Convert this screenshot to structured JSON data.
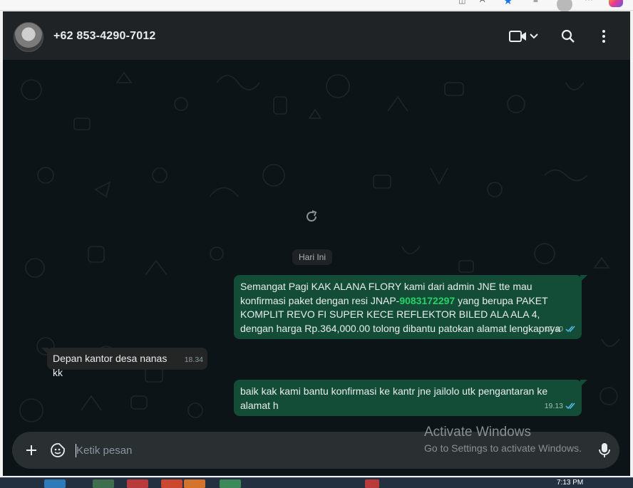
{
  "browser": {
    "icons": [
      "reader-icon",
      "font-icon",
      "star-icon",
      "extensions-icon",
      "profile-icon",
      "more-icon",
      "copilot-icon"
    ]
  },
  "chat": {
    "contact_name": "+62 853-4290-7012",
    "date_divider": "Hari Ini",
    "messages": [
      {
        "direction": "out",
        "text_before": "Semangat Pagi KAK ALANA FLORY kami dari admin JNE tte mau konfirmasi paket dengan resi JNAP-",
        "resi": "9083172297",
        "text_after": " yang berupa PAKET KOMPLIT REVO FI SUPER KECE REFLEKTOR BILED ALA ALA 4, dengan harga Rp.364,000.00 tolong dibantu patokan alamat lengkapnya",
        "time": "17.40",
        "status": "read"
      },
      {
        "direction": "in",
        "text": "Depan kantor desa nanas kk",
        "time": "18.34"
      },
      {
        "direction": "out",
        "text": "baik kak kami bantu konfirmasi ke kantr jne jailolo utk pengantaran ke alamat h",
        "time": "19.13",
        "status": "read"
      }
    ],
    "composer": {
      "placeholder": "Ketik pesan"
    }
  },
  "watermark": {
    "title": "Activate Windows",
    "subtitle": "Go to Settings to activate Windows."
  },
  "taskbar": {
    "time": "7:13 PM"
  },
  "colors": {
    "header_bg": "#1f2326",
    "outgoing_bubble": "#134d37",
    "incoming_bubble": "#242626",
    "resi_link": "#25d366",
    "read_ticks": "#53bdeb"
  }
}
